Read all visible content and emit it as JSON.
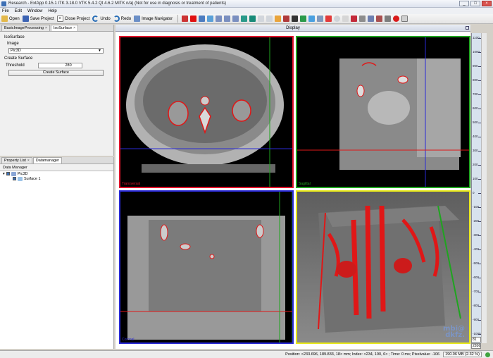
{
  "window": {
    "title": "Research - ExtApp 0.15.1 ITK 3.18.0  VTK 5.4.2 Qt 4.6.2 MITK n/a) (Not for use in diagnosis or treatment of patients)",
    "min": "_",
    "max": "□",
    "close": "×"
  },
  "menu": {
    "items": [
      "File",
      "Edit",
      "Window",
      "Help"
    ]
  },
  "toolbar": {
    "open": "Open",
    "save_project": "Save Project",
    "close_project": "Close Project",
    "undo": "Undo",
    "redo": "Redo",
    "image_navigator": "Image Navigator"
  },
  "left_tabs": {
    "tab1": "BasicImageProcessing",
    "tab2": "IsoSurface",
    "close": "×"
  },
  "isosurface": {
    "heading": "IsoSurface",
    "image_label": "Image",
    "image_value": "Pic3D",
    "create_surface_label": "Create Surface",
    "threshold_label": "Threshold",
    "threshold_value": "280",
    "create_button": "Create Surface"
  },
  "bottom_tabs": {
    "tab1": "Property List",
    "tab2": "Datamanager"
  },
  "data_manager": {
    "heading": "Data Manager",
    "node1": "Pic3D",
    "node2": "Surface 1"
  },
  "display": {
    "title": "Display",
    "labels": {
      "axial": "Transversal",
      "sagittal": "Sagittal",
      "coronal": "Coronal"
    },
    "logo_line1": "mbi@",
    "logo_line2": "dkfz."
  },
  "ruler": {
    "labels": [
      "1100",
      "1000",
      "900",
      "800",
      "700",
      "600",
      "500",
      "400",
      "300",
      "200",
      "100",
      "0",
      "-100",
      "-200",
      "-300",
      "-400",
      "-500",
      "-600",
      "-700",
      "-800",
      "-900",
      "-1000"
    ],
    "level": "81",
    "window": "2206"
  },
  "status": {
    "position": "Position: <233.696, 189.833, 18> mm; Index: <234, 190, 6> ; Time: 0 ms; Pixelvalue: -106",
    "memory": "190.06 MB (2.32 %)"
  },
  "colors": {
    "axial_frame": "#e0142b",
    "sagittal_frame": "#1fa51f",
    "coronal_frame": "#2a2ad6",
    "threed_frame": "#e8e81a",
    "surface": "#e01717"
  }
}
